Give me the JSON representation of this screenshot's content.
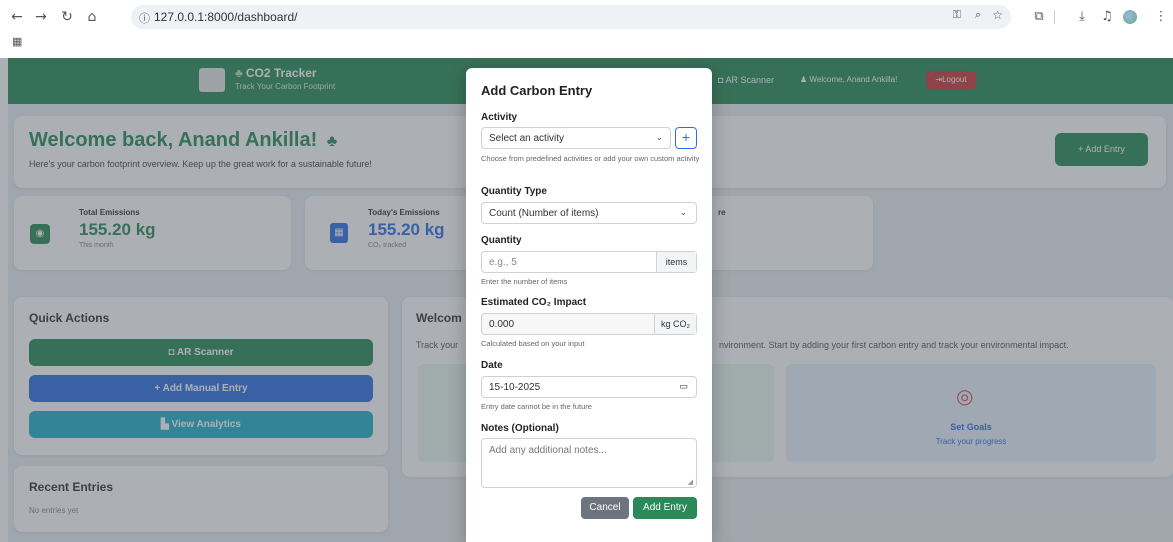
{
  "browser": {
    "url": "127.0.0.1:8000/dashboard/",
    "info_icon": "ⓘ"
  },
  "navbar": {
    "brand_title": "CO2 Tracker",
    "brand_subtitle": "Track Your Carbon Footprint",
    "ar_scanner": "AR Scanner",
    "welcome": "Welcome, Anand Ankilla!",
    "logout": "Logout"
  },
  "welcome": {
    "title": "Welcome back, Anand Ankilla!",
    "subtitle": "Here's your carbon footprint overview. Keep up the great work for a sustainable future!",
    "add_entry": "+ Add Entry"
  },
  "stats": [
    {
      "label": "Total Emissions",
      "value": "155.20 kg",
      "sub": "This month"
    },
    {
      "label": "Today's Emissions",
      "value": "155.20 kg",
      "sub": "CO₂ tracked"
    },
    {
      "label": "re"
    }
  ],
  "quick_actions": {
    "title": "Quick Actions",
    "ar_scanner": "AR Scanner",
    "add_manual": "+ Add Manual Entry",
    "view_analytics": "View Analytics"
  },
  "welcome_panel": {
    "title": "Welcom",
    "text_left": "Track your",
    "text_right": "nvironment. Start by adding your first carbon entry and track your environmental impact.",
    "goal_title": "Set Goals",
    "goal_sub": "Track your progress"
  },
  "recent": {
    "title": "Recent Entries",
    "empty": "No entries yet"
  },
  "modal": {
    "title": "Add Carbon Entry",
    "activity_label": "Activity",
    "activity_value": "Select an activity",
    "activity_add": "+",
    "activity_help": "Choose from predefined activities or add your own custom activity",
    "qtype_label": "Quantity Type",
    "qtype_value": "Count (Number of items)",
    "quantity_label": "Quantity",
    "quantity_placeholder": "e.g., 5",
    "quantity_unit": "items",
    "quantity_help": "Enter the number of items",
    "impact_label": "Estimated CO₂ Impact",
    "impact_value": "0.000",
    "impact_unit": "kg CO₂",
    "impact_help": "Calculated based on your input",
    "date_label": "Date",
    "date_value": "15-10-2025",
    "date_help": "Entry date cannot be in the future",
    "notes_label": "Notes (Optional)",
    "notes_placeholder": "Add any additional notes...",
    "cancel": "Cancel",
    "submit": "Add Entry"
  },
  "colors": {
    "green": "#2a8a57",
    "blue": "#2f6fe0",
    "cyan": "#1fb1c9",
    "red": "#c83a3a"
  }
}
